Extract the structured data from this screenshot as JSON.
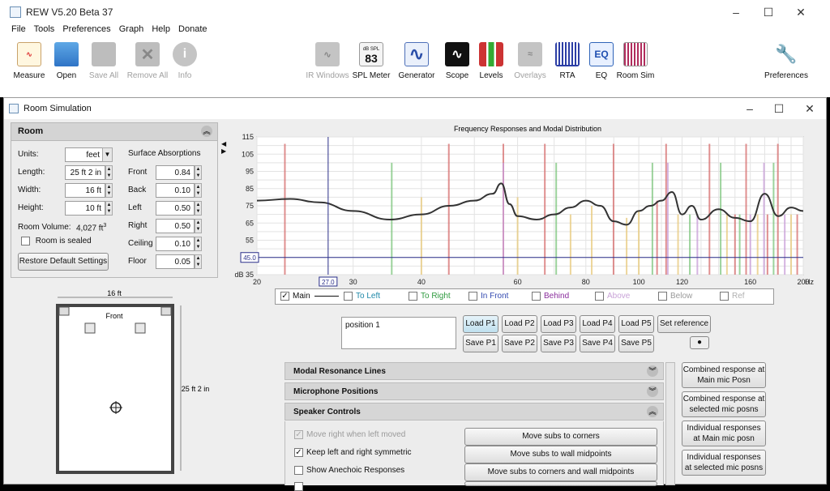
{
  "main_window": {
    "title": "REW V5.20 Beta 37",
    "controls": [
      "–",
      "☐",
      "✕"
    ],
    "menu": [
      "File",
      "Tools",
      "Preferences",
      "Graph",
      "Help",
      "Donate"
    ],
    "toolbar": [
      {
        "label": "Measure",
        "icon": "measure-icon",
        "enabled": true
      },
      {
        "label": "Open",
        "icon": "folder-icon",
        "enabled": true
      },
      {
        "label": "Save All",
        "icon": "save-icon",
        "enabled": false
      },
      {
        "label": "Remove All",
        "icon": "remove-icon",
        "enabled": false
      },
      {
        "label": "Info",
        "icon": "info-icon",
        "enabled": false
      },
      {
        "label": "IR Windows",
        "icon": "ir-windows-icon",
        "enabled": false
      },
      {
        "label": "SPL Meter",
        "icon": "spl-meter-icon",
        "enabled": true,
        "ico_top": "dB SPL",
        "ico_value": "83"
      },
      {
        "label": "Generator",
        "icon": "generator-icon",
        "enabled": true
      },
      {
        "label": "Scope",
        "icon": "scope-icon",
        "enabled": true
      },
      {
        "label": "Levels",
        "icon": "levels-icon",
        "enabled": true
      },
      {
        "label": "Overlays",
        "icon": "overlays-icon",
        "enabled": false
      },
      {
        "label": "RTA",
        "icon": "rta-icon",
        "enabled": true
      },
      {
        "label": "EQ",
        "icon": "eq-icon",
        "enabled": true,
        "ico_text": "EQ"
      },
      {
        "label": "Room Sim",
        "icon": "room-sim-icon",
        "enabled": true
      },
      {
        "label": "Preferences",
        "icon": "wrench-icon",
        "enabled": true
      }
    ]
  },
  "room_window": {
    "title": "Room Simulation",
    "controls": [
      "–",
      "☐",
      "✕"
    ]
  },
  "room_panel": {
    "title": "Room",
    "units_label": "Units:",
    "units_value": "feet",
    "length_label": "Length:",
    "length_value": "25 ft 2 in",
    "width_label": "Width:",
    "width_value": "16 ft",
    "height_label": "Height:",
    "height_value": "10 ft",
    "volume_label": "Room Volume:",
    "volume_value": "4,027 ft",
    "volume_sup": "3",
    "sealed_label": "Room is sealed",
    "restore_label": "Restore Default Settings",
    "absorptions_title": "Surface Absorptions",
    "absorptions": [
      {
        "label": "Front",
        "value": "0.84"
      },
      {
        "label": "Back",
        "value": "0.10"
      },
      {
        "label": "Left",
        "value": "0.50"
      },
      {
        "label": "Right",
        "value": "0.50"
      },
      {
        "label": "Ceiling",
        "value": "0.10"
      },
      {
        "label": "Floor",
        "value": "0.05"
      }
    ]
  },
  "room_plan": {
    "width_label": "16 ft",
    "length_label": "25 ft 2 in",
    "front_label": "Front"
  },
  "chart_data": {
    "type": "line",
    "title": "Frequency Responses and Modal Distribution",
    "xlabel": "Hz",
    "ylabel": "dB",
    "x_scale": "log",
    "xlim": [
      20,
      200
    ],
    "ylim": [
      35,
      115
    ],
    "x_ticks": [
      "20",
      "30",
      "40",
      "60",
      "80",
      "100",
      "120",
      "160",
      "200"
    ],
    "x_tick_values": [
      20,
      30,
      40,
      60,
      80,
      100,
      120,
      160,
      200
    ],
    "y_ticks": [
      "115",
      "105",
      "95",
      "85",
      "75",
      "65",
      "55",
      "45",
      "35"
    ],
    "cursor_x": "27.0",
    "cursor_y": "45.0",
    "grid": true,
    "series": [
      {
        "name": "Main",
        "color": "#333333",
        "x": [
          20,
          23,
          26,
          30,
          35,
          40,
          45,
          50,
          54,
          56,
          58,
          60,
          65,
          70,
          75,
          80,
          85,
          90,
          95,
          100,
          105,
          110,
          115,
          120,
          125,
          130,
          140,
          150,
          160,
          170,
          180,
          190,
          200
        ],
        "y": [
          78,
          79,
          77,
          72,
          67,
          70,
          75,
          78,
          82,
          88,
          76,
          69,
          67,
          70,
          74,
          78,
          75,
          66,
          64,
          72,
          75,
          78,
          83,
          70,
          75,
          67,
          73,
          68,
          66,
          82,
          69,
          74,
          72
        ]
      }
    ],
    "modal_lines": [
      {
        "f": 22.5,
        "color": "#d66b6b",
        "level": 111
      },
      {
        "f": 44.9,
        "color": "#d66b6b",
        "level": 111
      },
      {
        "f": 35.3,
        "color": "#7cc57c",
        "level": 100
      },
      {
        "f": 56.5,
        "color": "#d66b6b",
        "level": 111
      },
      {
        "f": 70.6,
        "color": "#7cc57c",
        "level": 100
      },
      {
        "f": 56.5,
        "color": "#c89bd8",
        "level": 100
      },
      {
        "f": 67.3,
        "color": "#d66b6b",
        "level": 111
      },
      {
        "f": 89.9,
        "color": "#d66b6b",
        "level": 111
      },
      {
        "f": 105.9,
        "color": "#7cc57c",
        "level": 100
      },
      {
        "f": 112.2,
        "color": "#d66b6b",
        "level": 111
      },
      {
        "f": 134.7,
        "color": "#d66b6b",
        "level": 111
      },
      {
        "f": 141.2,
        "color": "#7cc57c",
        "level": 100
      },
      {
        "f": 157.2,
        "color": "#d66b6b",
        "level": 111
      },
      {
        "f": 176.5,
        "color": "#7cc57c",
        "level": 100
      },
      {
        "f": 179.7,
        "color": "#d66b6b",
        "level": 111
      },
      {
        "f": 113.0,
        "color": "#c89bd8",
        "level": 100
      },
      {
        "f": 169.5,
        "color": "#c89bd8",
        "level": 100
      },
      {
        "f": 40.0,
        "color": "#e8c97a",
        "level": 80
      },
      {
        "f": 60.0,
        "color": "#e8c97a",
        "level": 80
      },
      {
        "f": 75.0,
        "color": "#e8c97a",
        "level": 70
      },
      {
        "f": 82.0,
        "color": "#e8c97a",
        "level": 75
      },
      {
        "f": 95.0,
        "color": "#e8c97a",
        "level": 68
      },
      {
        "f": 100.0,
        "color": "#e8c97a",
        "level": 72
      },
      {
        "f": 108.0,
        "color": "#d66b6b",
        "level": 78
      },
      {
        "f": 118.0,
        "color": "#e8c97a",
        "level": 70
      },
      {
        "f": 124.0,
        "color": "#7cc57c",
        "level": 70
      },
      {
        "f": 128.0,
        "color": "#c89bd8",
        "level": 70
      },
      {
        "f": 145.0,
        "color": "#e8c97a",
        "level": 70
      },
      {
        "f": 150.0,
        "color": "#d66b6b",
        "level": 70
      },
      {
        "f": 153.0,
        "color": "#7cc57c",
        "level": 70
      },
      {
        "f": 160.0,
        "color": "#c89bd8",
        "level": 70
      },
      {
        "f": 165.0,
        "color": "#e8c97a",
        "level": 70
      },
      {
        "f": 172.0,
        "color": "#d66b6b",
        "level": 70
      },
      {
        "f": 185.0,
        "color": "#c89bd8",
        "level": 70
      },
      {
        "f": 190.0,
        "color": "#e8c97a",
        "level": 70
      },
      {
        "f": 195.0,
        "color": "#d66b6b",
        "level": 70
      }
    ]
  },
  "legend": [
    {
      "label": "Main",
      "checked": true,
      "color": "#111111"
    },
    {
      "label": "To Left",
      "checked": false,
      "color": "#1e88a8"
    },
    {
      "label": "To Right",
      "checked": false,
      "color": "#2e9a3e"
    },
    {
      "label": "In Front",
      "checked": false,
      "color": "#3148b0"
    },
    {
      "label": "Behind",
      "checked": false,
      "color": "#8a2d9c"
    },
    {
      "label": "Above",
      "checked": false,
      "color": "#c9a3d8"
    },
    {
      "label": "Below",
      "checked": false,
      "color": "#9a9a9a"
    },
    {
      "label": "Ref",
      "checked": false,
      "color": "#b0b0b0"
    }
  ],
  "positions": {
    "name_value": "position 1",
    "load_buttons": [
      "Load P1",
      "Load P2",
      "Load P3",
      "Load P4",
      "Load P5"
    ],
    "save_buttons": [
      "Save P1",
      "Save P2",
      "Save P3",
      "Save P4",
      "Save P5"
    ],
    "set_reference": "Set reference"
  },
  "sections": [
    {
      "label": "Modal Resonance Lines",
      "collapsed": true
    },
    {
      "label": "Microphone Positions",
      "collapsed": true
    },
    {
      "label": "Speaker Controls",
      "collapsed": false
    }
  ],
  "speaker_controls": {
    "options": [
      {
        "label": "Move right when left moved",
        "checked": true,
        "enabled": false
      },
      {
        "label": "Keep left and right symmetric",
        "checked": true,
        "enabled": true
      },
      {
        "label": "Show Anechoic Responses",
        "checked": false,
        "enabled": true
      }
    ],
    "buttons": [
      "Move subs to corners",
      "Move subs to wall midpoints",
      "Move subs to corners and wall midpoints"
    ]
  },
  "response_buttons": [
    "Combined response at Main mic Posn",
    "Combined response at selected mic posns",
    "Individual responses at Main mic posn",
    "Individual responses at selected mic posns"
  ]
}
